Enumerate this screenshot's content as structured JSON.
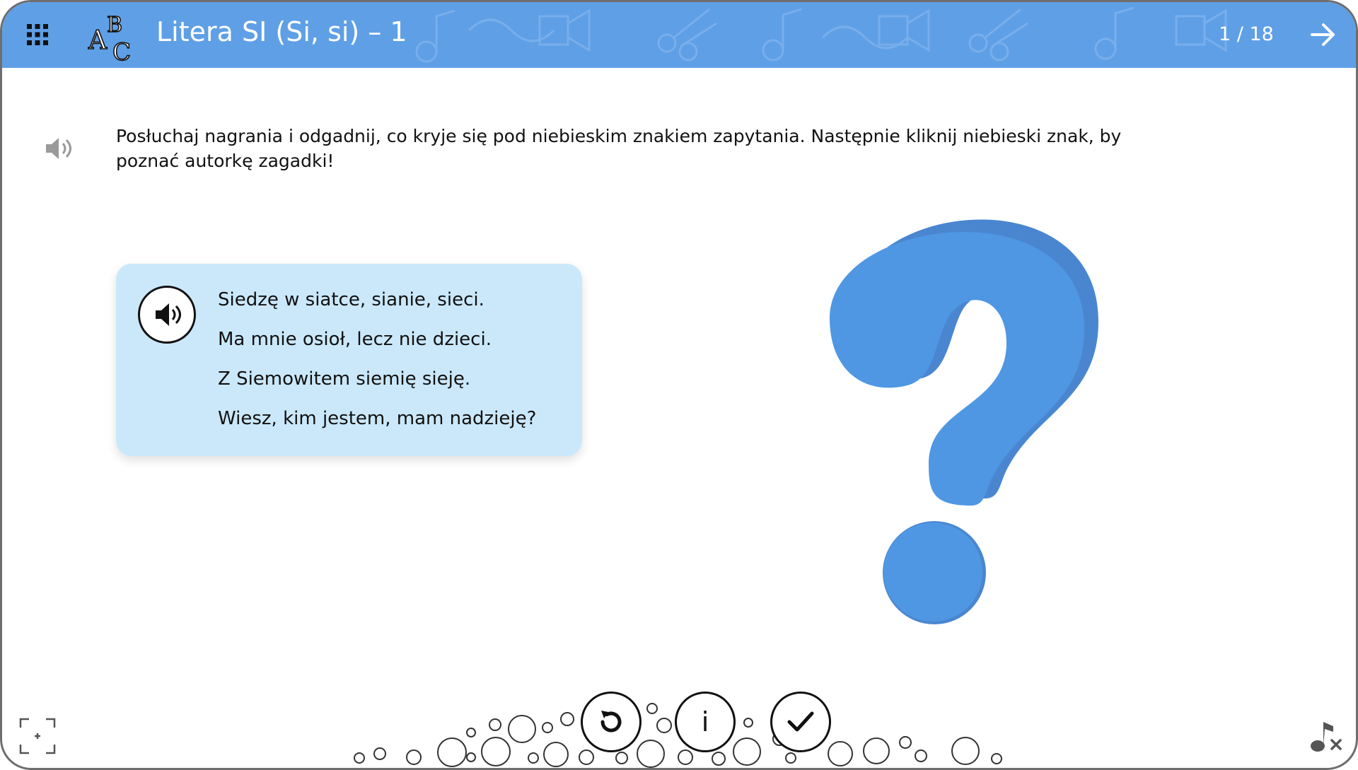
{
  "header": {
    "title": "Litera SI (Si, si) – 1",
    "page_counter": "1 / 18",
    "menu_icon": "grid-icon",
    "logo_letters": [
      "A",
      "B",
      "C"
    ],
    "next_icon": "arrow-right-icon",
    "background_color": "#5f9fe6"
  },
  "instruction": {
    "text": "Posłuchaj nagrania i odgadnij, co kryje się pod niebieskim znakiem zapytania. Następnie kliknij niebieski znak, by poznać autorkę zagadki!",
    "speaker_icon": "speaker-icon"
  },
  "poem": {
    "audio_icon": "speaker-icon",
    "lines": [
      "Siedzę w siatce, sianie, sieci.",
      "Ma mnie osioł, lecz nie dzieci.",
      "Z Siemowitem siemię sieję.",
      "Wiesz, kim jestem, mam nadzieję?"
    ],
    "background_color": "#cbe8fa"
  },
  "question_mark": {
    "icon": "question-mark-icon",
    "color": "#4f97e3"
  },
  "controls": {
    "reset_icon": "reset-icon",
    "info_label": "i",
    "check_icon": "checkmark-icon"
  },
  "footer": {
    "fullscreen_icon": "fullscreen-icon",
    "music_off_icon": "music-off-icon"
  }
}
